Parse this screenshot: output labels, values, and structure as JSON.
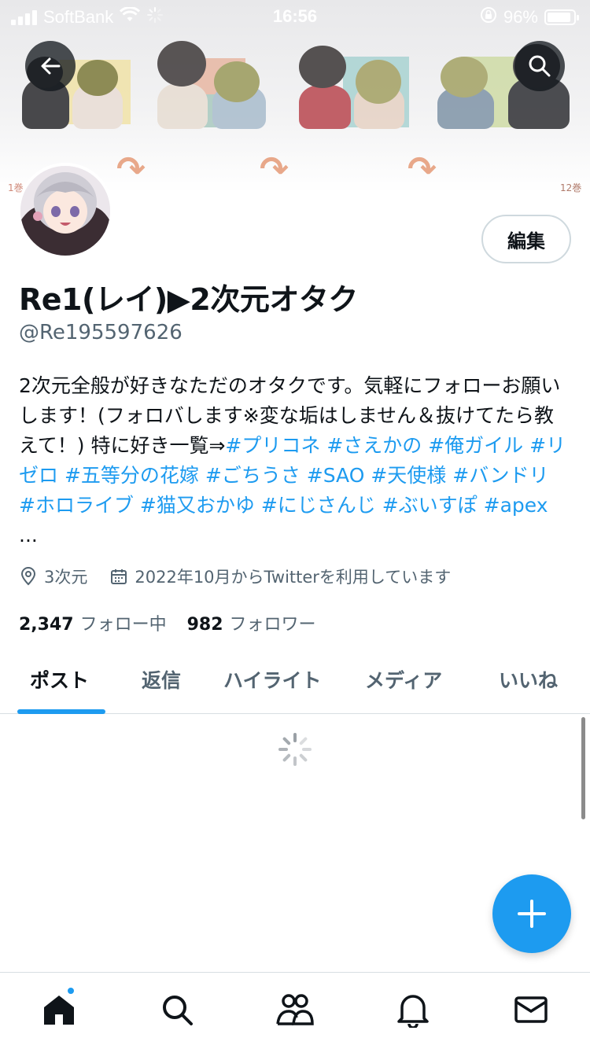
{
  "status_bar": {
    "carrier": "SoftBank",
    "time": "16:56",
    "battery": "96%"
  },
  "profile": {
    "edit_label": "編集",
    "display_name": "Re1(レイ)▶2次元オタク",
    "handle": "@Re195597626",
    "bio_text": "2次元全般が好きなただのオタクです。気軽にフォローお願いします！(フォロバします※変な垢はしません＆抜けてたら教えて！) 特に好き一覧⇒",
    "bio_tags": [
      "#プリコネ",
      "#さえかの",
      "#俺ガイル",
      "#リゼロ",
      "#五等分の花嫁",
      "#ごちうさ",
      "#SAO",
      "#天使様",
      "#バンドリ",
      "#ホロライブ",
      "#猫又おかゆ",
      "#にじさんじ",
      "#ぶいすぽ",
      "#apex"
    ],
    "bio_ellipsis": "...",
    "location": "3次元",
    "joined": "2022年10月からTwitterを利用しています",
    "following_count": "2,347",
    "following_label": "フォロー中",
    "followers_count": "982",
    "followers_label": "フォロワー"
  },
  "banner": {
    "left_mark": "1巻",
    "right_mark": "12巻"
  },
  "tabs": [
    {
      "label": "ポスト",
      "active": true
    },
    {
      "label": "返信",
      "active": false
    },
    {
      "label": "ハイライト",
      "active": false
    },
    {
      "label": "メディア",
      "active": false
    },
    {
      "label": "いいね",
      "active": false
    }
  ],
  "bottom_nav": [
    {
      "icon": "home-icon",
      "badge": true
    },
    {
      "icon": "search-icon",
      "badge": false
    },
    {
      "icon": "communities-icon",
      "badge": false
    },
    {
      "icon": "bell-icon",
      "badge": false
    },
    {
      "icon": "mail-icon",
      "badge": false
    }
  ],
  "colors": {
    "accent": "#1d9bf0",
    "text_primary": "#0f1419",
    "text_secondary": "#536471"
  }
}
